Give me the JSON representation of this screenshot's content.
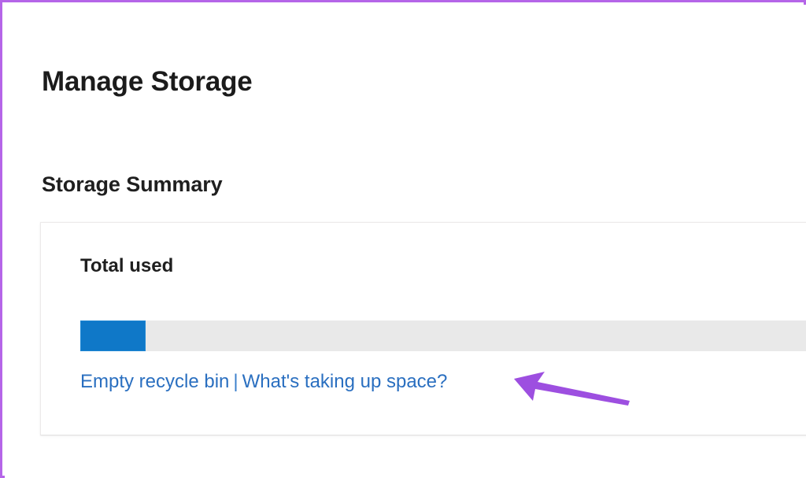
{
  "page": {
    "title": "Manage Storage",
    "section_heading": "Storage Summary"
  },
  "storage_card": {
    "label": "Total used",
    "progress": {
      "percent": 8.3,
      "fill_color": "#0f78c8",
      "track_color": "#e9e9e9"
    },
    "links": {
      "empty_recycle_bin": "Empty recycle bin",
      "separator": "|",
      "whats_taking_up_space": "What's taking up space?",
      "link_color": "#2a6fc0"
    }
  },
  "annotation": {
    "arrow_name": "left-pointing-arrow",
    "arrow_color": "#9d4fe0",
    "points_at": "What's taking up space?"
  },
  "frame": {
    "border_color": "#b565e8"
  }
}
